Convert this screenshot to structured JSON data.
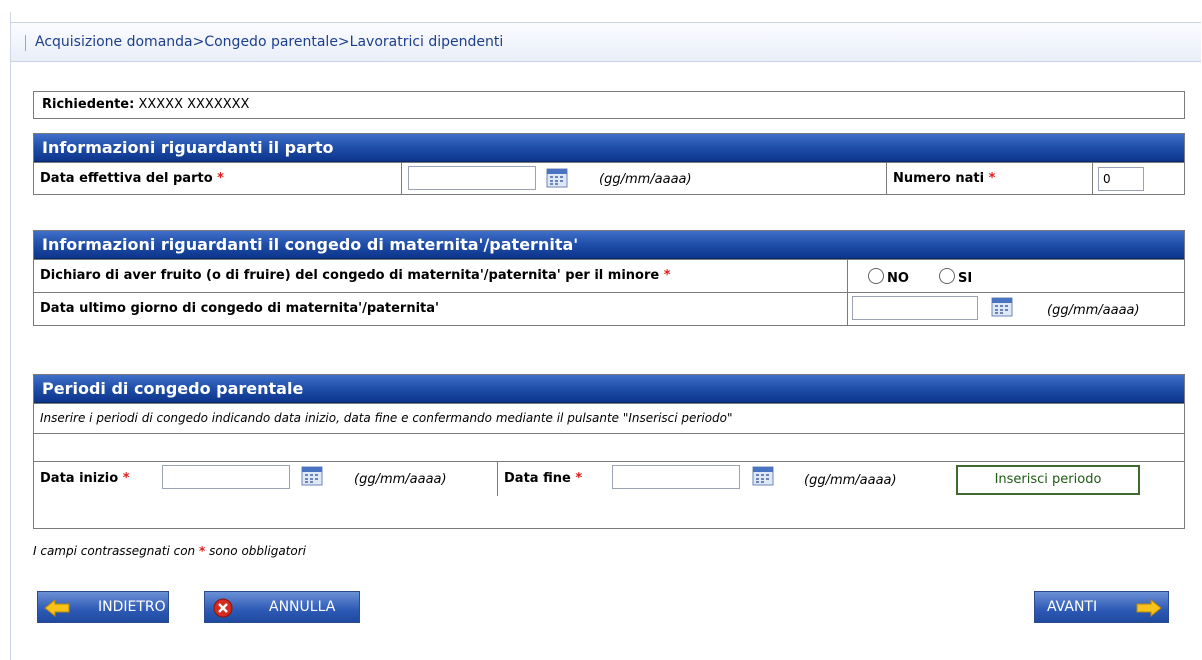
{
  "breadcrumb": "Acquisizione domanda>Congedo parentale>Lavoratrici dipendenti",
  "richiedente": {
    "label": "Richiedente:",
    "value": "XXXXX XXXXXXX"
  },
  "parto": {
    "title": "Informazioni riguardanti il parto",
    "data_label": "Data effettiva del parto",
    "data_value": "",
    "format": "(gg/mm/aaaa)",
    "numero_label": "Numero nati",
    "numero_value": "0"
  },
  "maternita": {
    "title": "Informazioni riguardanti il congedo di maternita'/paternita'",
    "dichiaro_label": "Dichiaro di aver fruito (o di fruire) del congedo di maternita'/paternita' per il minore",
    "radio_no": "NO",
    "radio_si": "SI",
    "ultimo_label": "Data ultimo giorno di congedo di maternita'/paternita'",
    "ultimo_value": "",
    "format": "(gg/mm/aaaa)"
  },
  "periodi": {
    "title": "Periodi di congedo parentale",
    "instructions": "Inserire i periodi di congedo indicando data inizio, data fine e confermando mediante il pulsante \"Inserisci periodo\"",
    "inizio_label": "Data inizio",
    "inizio_value": "",
    "fine_label": "Data fine",
    "fine_value": "",
    "format": "(gg/mm/aaaa)",
    "insert_button": "Inserisci periodo"
  },
  "required_marker": "*",
  "footnote_before": "I campi contrassegnati con",
  "footnote_after": "sono obbligatori",
  "buttons": {
    "indietro": "INDIETRO",
    "annulla": "ANNULLA",
    "avanti": "AVANTI"
  },
  "icons": {
    "calendar": "calendar-icon",
    "back": "arrow-left-icon",
    "cancel": "cancel-x-icon",
    "forward": "arrow-right-icon"
  }
}
